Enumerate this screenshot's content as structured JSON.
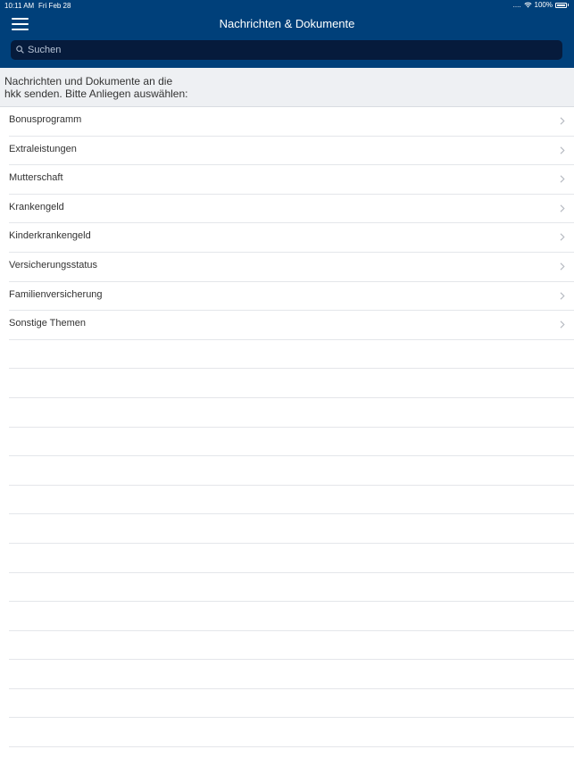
{
  "status_bar": {
    "time": "10:11 AM",
    "date": "Fri Feb 28",
    "signal": "....",
    "battery": "100%"
  },
  "header": {
    "title": "Nachrichten & Dokumente",
    "menu_icon": "hamburger-menu-icon"
  },
  "search": {
    "placeholder": "Suchen",
    "icon": "search-icon"
  },
  "intro": {
    "text": "Nachrichten und Dokumente an die hkk senden. Bitte Anliegen auswählen:"
  },
  "topics": [
    {
      "label": "Bonusprogramm"
    },
    {
      "label": "Extraleistungen"
    },
    {
      "label": "Mutterschaft"
    },
    {
      "label": "Krankengeld"
    },
    {
      "label": "Kinderkrankengeld"
    },
    {
      "label": "Versicherungsstatus"
    },
    {
      "label": "Familienversicherung"
    },
    {
      "label": "Sonstige Themen"
    }
  ],
  "colors": {
    "header_bg": "#00407a",
    "search_bg": "#061b3c",
    "intro_bg": "#eef0f3",
    "text": "#333333",
    "divider": "#e4e6ea",
    "chevron": "#b4b8bf"
  }
}
